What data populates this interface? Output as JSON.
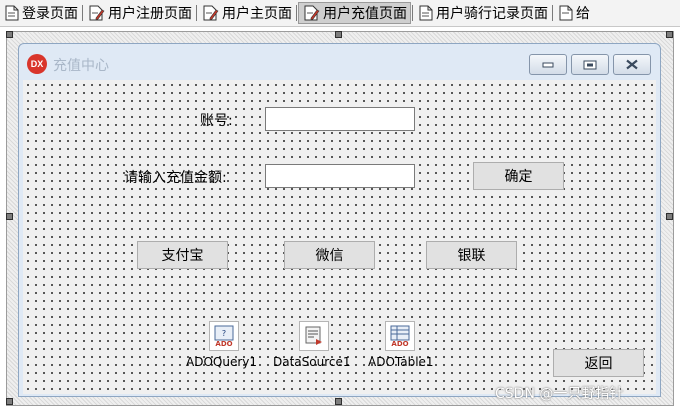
{
  "tabs": [
    {
      "label": "登录页面",
      "active": false,
      "icon": "form-file-icon"
    },
    {
      "label": "用户注册页面",
      "active": false,
      "icon": "form-edit-icon"
    },
    {
      "label": "用户主页面",
      "active": false,
      "icon": "form-edit-icon"
    },
    {
      "label": "用户充值页面",
      "active": true,
      "icon": "form-edit-icon"
    },
    {
      "label": "用户骑行记录页面",
      "active": false,
      "icon": "form-file-icon"
    },
    {
      "label": "给",
      "active": false,
      "icon": "form-file-icon"
    }
  ],
  "form": {
    "logo_text": "DX",
    "title": "充值中心",
    "window_buttons": [
      "minimize",
      "maximize",
      "close"
    ]
  },
  "fields": {
    "account_label": "账号:",
    "account_value": "",
    "amount_label": "请输入充值金额:",
    "amount_value": ""
  },
  "buttons": {
    "confirm": "确定",
    "alipay": "支付宝",
    "wechat": "微信",
    "unionpay": "银联",
    "back": "返回"
  },
  "components": [
    {
      "name": "ADOQuery1",
      "icon": "ado-query-icon"
    },
    {
      "name": "DataSource1",
      "icon": "datasource-icon"
    },
    {
      "name": "ADOTable1",
      "icon": "ado-table-icon"
    }
  ],
  "watermark": "CSDN @一只野指针",
  "colors": {
    "logo": "#d9352b",
    "title_text": "#a9b7c8",
    "form_frame": "#dfe9f5",
    "active_tab": "#cfcfcf"
  }
}
